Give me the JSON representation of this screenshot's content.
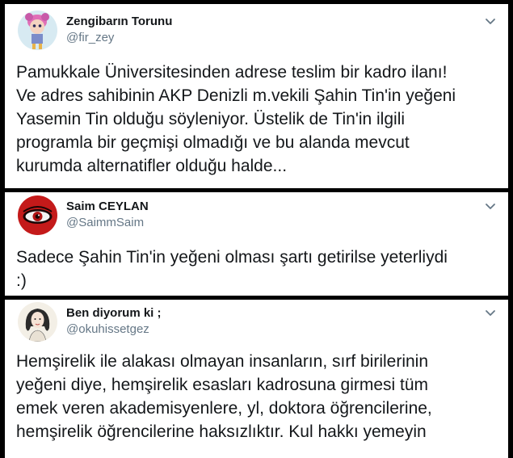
{
  "tweets": [
    {
      "display_name": "Zengibarın Torunu",
      "handle": "@fir_zey",
      "avatar_icon": "cartoon-doll-avatar",
      "lines": [
        "Pamukkale Üniversitesinden adrese teslim bir kadro ilanı!",
        "Ve adres sahibinin AKP Denizli m.vekili Şahin Tin'in yeğeni",
        "Yasemin Tin olduğu söyleniyor. Üstelik de Tin'in ilgili",
        "programla bir geçmişi olmadığı ve bu alanda mevcut",
        "kurumda alternatifler olduğu halde..."
      ]
    },
    {
      "display_name": "Saim CEYLAN",
      "handle": "@SaimmSaim",
      "avatar_icon": "red-eye-avatar",
      "lines": [
        "Sadece Şahin Tin'in yeğeni olması şartı getirilse yeterliydi",
        ":)"
      ]
    },
    {
      "display_name": "Ben diyorum ki ;",
      "handle": "@okuhissetgez",
      "avatar_icon": "sketch-girl-avatar",
      "lines": [
        "Hemşirelik ile alakası olmayan insanların, sırf birilerinin",
        "yeğeni diye, hemşirelik esasları kadrosuna girmesi tüm",
        "emek veren akademisyenlere, yl, doktora öğrencilerine,",
        "hemşirelik öğrencilerine haksızlıktır. Kul hakkı yemeyin"
      ]
    }
  ],
  "chevron_icon": "chevron-down-icon"
}
